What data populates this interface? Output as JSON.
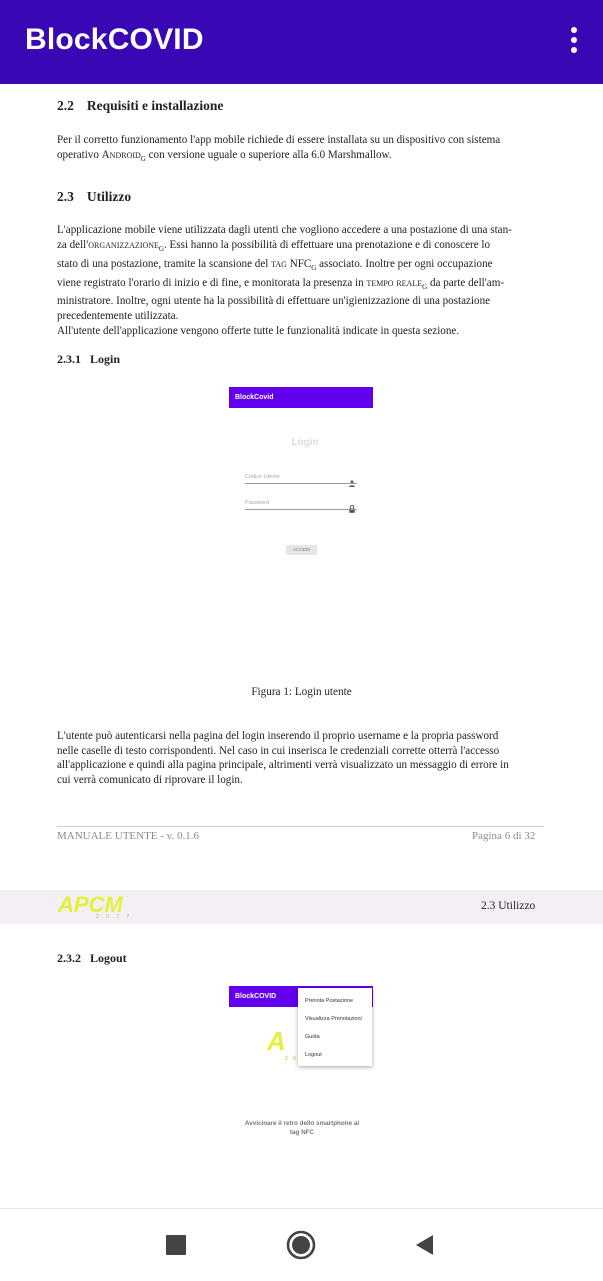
{
  "appbar": {
    "title": "BlockCOVID"
  },
  "doc": {
    "s22": {
      "num": "2.2",
      "title": "Requisiti e installazione"
    },
    "p22": {
      "l1": "Per il corretto funzionamento l'app mobile richiede di essere installata su un dispositivo con sistema",
      "l2a": "operativo ",
      "l2term": "Android",
      "l2b": " con versione uguale o superiore alla 6.0 Marshmallow."
    },
    "s23": {
      "num": "2.3",
      "title": "Utilizzo"
    },
    "p23": {
      "l1": "L'applicazione mobile viene utilizzata dagli utenti che vogliono accedere a una postazione di una stan-",
      "l2a": "za dell'",
      "l2term": "organizzazione",
      "l2b": ". Essi hanno la possibilità di effettuare una prenotazione e di conoscere lo",
      "l3a": "stato di una postazione, tramite la scansione del ",
      "l3term": "tag",
      "l3b": " NFC",
      "l3c": " associato. Inoltre per ogni occupazione",
      "l4a": "viene registrato l'orario di inizio e di fine, e monitorata la presenza in ",
      "l4term": "tempo reale",
      "l4b": " da parte dell'am-",
      "l5": "ministratore. Inoltre, ogni utente ha la possibilità di effettuare un'igienizzazione di una postazione",
      "l6": "precedentemente utilizzata.",
      "l7": "All'utente dell'applicazione vengono offerte tutte le funzionalità indicate in questa sezione."
    },
    "glossary_mark": "G",
    "s231": {
      "num": "2.3.1",
      "title": "Login"
    },
    "fig1": {
      "appbar": "BlockCovid",
      "login_title": "Login",
      "user_placeholder": "Codice Utente",
      "password_placeholder": "Password",
      "button": "ACCEDI",
      "caption": "Figura 1: Login utente"
    },
    "p231": {
      "l1": "L'utente può autenticarsi nella pagina del login inserendo il proprio username e la propria password",
      "l2": "nelle caselle di testo corrispondenti. Nel caso in cui inserisca le credenziali corrette otterrà l'accesso",
      "l3": "all'applicazione e quindi alla pagina principale, altrimenti verrà visualizzato un messaggio di errore in",
      "l4": "cui verrà comunicato di riprovare il login."
    },
    "footer": {
      "left": "MANUALE UTENTE - v. 0.1.6",
      "right": "Pagina 6 di 32"
    },
    "header": {
      "section": "2.3 Utilizzo",
      "logo_text": "APCM",
      "logo_sub": "2 0 7 7"
    },
    "s232": {
      "num": "2.3.2",
      "title": "Logout"
    },
    "fig2": {
      "appbar": "BlockCOVID",
      "menu": [
        "Prenota Postazione",
        "Visualizza Prenotazioni",
        "Guida",
        "Logout"
      ],
      "hint": "Avvicinare il retro dello smartphone al tag NFC",
      "hint_l1": "Avvicinare il retro dello smartphone al",
      "hint_l2": "tag NFC",
      "logo_sub": "2 0"
    }
  },
  "colors": {
    "appbar": "#3a07b5",
    "figure_appbar": "#6200ee",
    "logo_yellow": "#e6f03a"
  },
  "navbar": {
    "icons": [
      "recent-apps-icon",
      "home-icon",
      "back-icon"
    ]
  }
}
